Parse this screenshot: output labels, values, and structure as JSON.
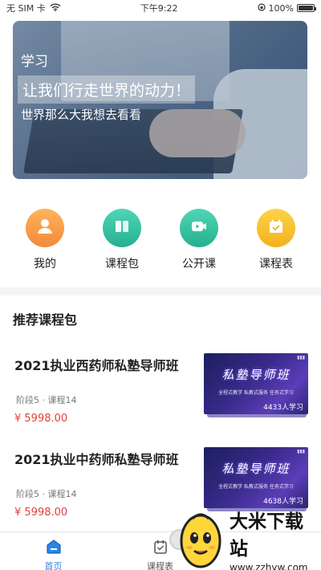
{
  "status_bar": {
    "carrier": "无 SIM 卡",
    "time": "下午9:22",
    "battery": "100%",
    "battery_level": 1.0
  },
  "banner": {
    "tag": "学习",
    "title": "让我们行走世界的动力！",
    "subtitle": "世界那么大我想去看看"
  },
  "nav": [
    {
      "label": "我的",
      "icon": "user-icon",
      "color": "#f5a04a"
    },
    {
      "label": "课程包",
      "icon": "book-icon",
      "color": "#38c6a3"
    },
    {
      "label": "公开课",
      "icon": "video-icon",
      "color": "#38c6a3"
    },
    {
      "label": "课程表",
      "icon": "calendar-icon",
      "color": "#f7c232"
    }
  ],
  "recommend": {
    "title": "推荐课程包",
    "courses": [
      {
        "title": "2021执业西药师私塾导师班",
        "meta": "阶段5 · 课程14",
        "price": "¥ 5998.00",
        "thumb_title": "私塾导师班",
        "thumb_slogan": "全程式教学 私教式服务 任务式学习",
        "learners": "4433人学习"
      },
      {
        "title": "2021执业中药师私塾导师班",
        "meta": "阶段5 · 课程14",
        "price": "¥ 5998.00",
        "thumb_title": "私塾导师班",
        "thumb_slogan": "全程式教学 私教式服务 任务式学习",
        "learners": "4638人学习"
      }
    ]
  },
  "tabs": [
    {
      "label": "首页",
      "icon": "home-icon",
      "active": true
    },
    {
      "label": "课程表",
      "icon": "calendar-icon",
      "active": false
    }
  ],
  "watermark": {
    "title": "大米下载站",
    "url": "www.zzhyw.com"
  },
  "colors": {
    "accent": "#2a86e8",
    "price": "#e0413b",
    "nav_orange": "#f5a04a",
    "nav_green": "#38c6a3",
    "nav_yellow": "#f7c232"
  }
}
